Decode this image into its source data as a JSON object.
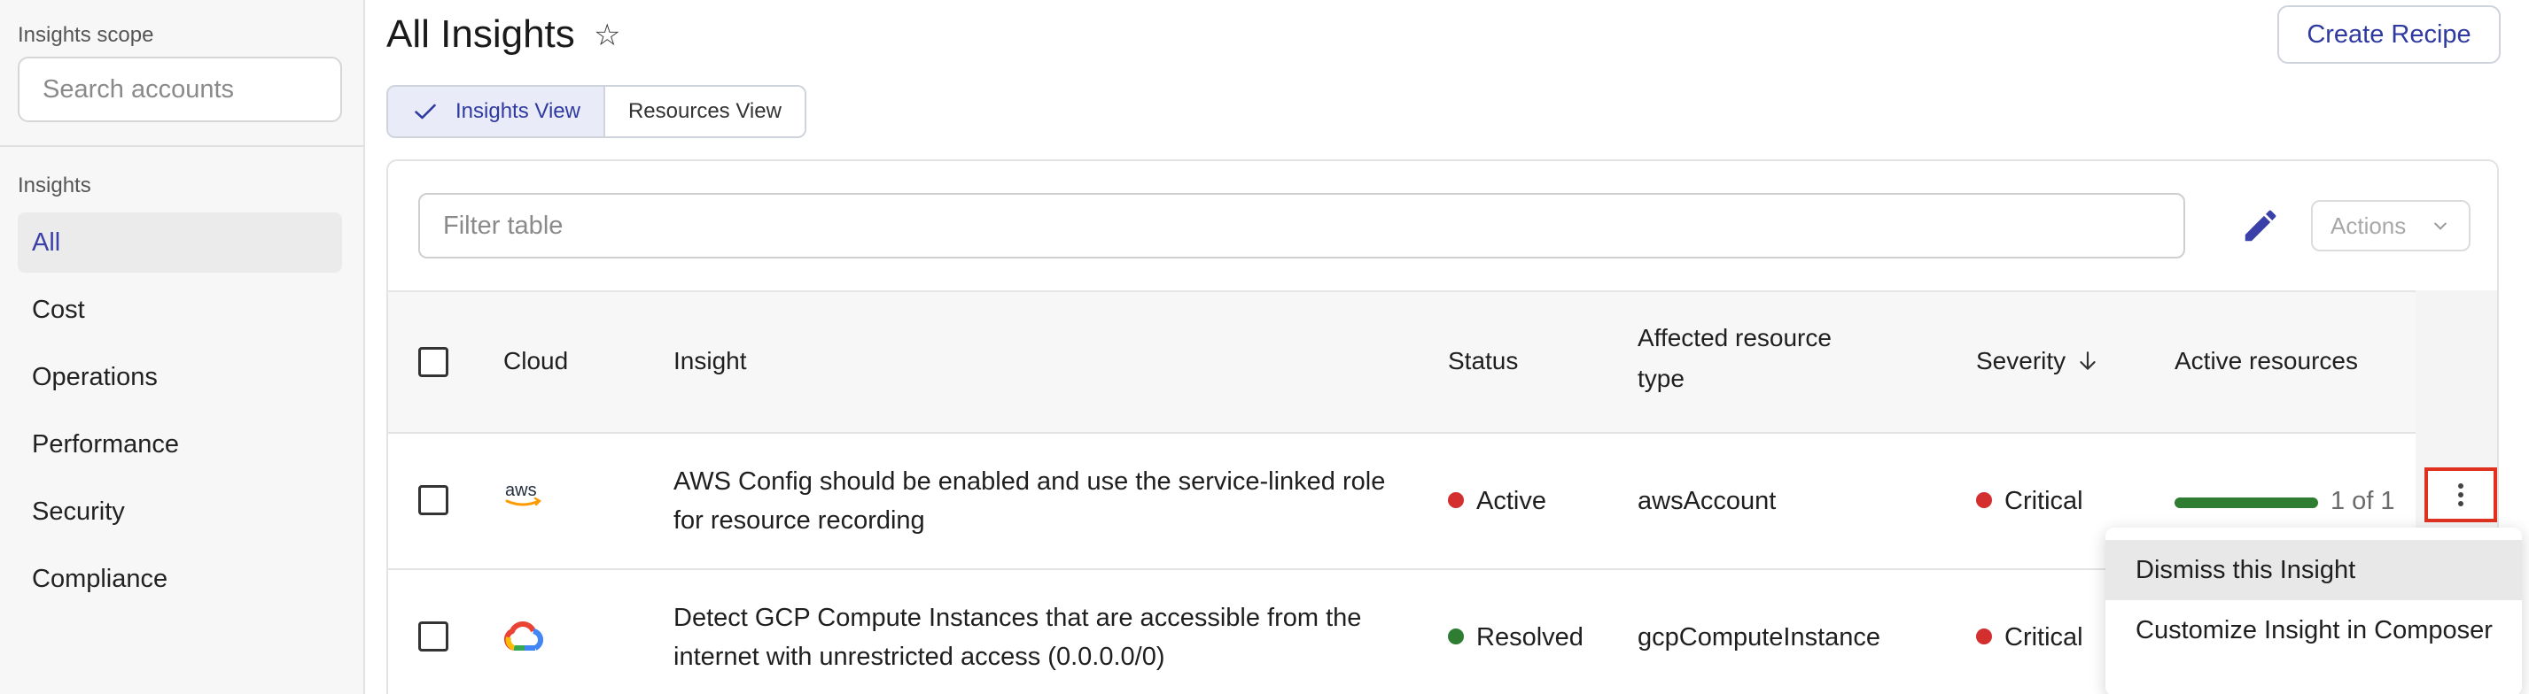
{
  "sidebar": {
    "scope_label": "Insights scope",
    "search_placeholder": "Search accounts",
    "insights_label": "Insights",
    "items": [
      {
        "label": "All",
        "active": true
      },
      {
        "label": "Cost"
      },
      {
        "label": "Operations"
      },
      {
        "label": "Performance"
      },
      {
        "label": "Security"
      },
      {
        "label": "Compliance"
      }
    ]
  },
  "header": {
    "title": "All Insights",
    "create_button": "Create Recipe"
  },
  "view_toggle": {
    "insights_view": "Insights View",
    "resources_view": "Resources View"
  },
  "toolbar": {
    "filter_placeholder": "Filter table",
    "actions_label": "Actions"
  },
  "table": {
    "columns": {
      "cloud": "Cloud",
      "insight": "Insight",
      "status": "Status",
      "affected_line1": "Affected resource",
      "affected_line2": "type",
      "severity": "Severity",
      "active_resources": "Active resources"
    },
    "rows": [
      {
        "cloud": "aws",
        "insight_line1": "AWS Config should be enabled and use the service-linked role",
        "insight_line2": "for resource recording",
        "status": "Active",
        "status_color": "#d32f2f",
        "resource_type": "awsAccount",
        "severity": "Critical",
        "severity_color": "#d32f2f",
        "active_resources": "1 of 1",
        "active_fraction": 1.0
      },
      {
        "cloud": "gcp",
        "insight_line1": "Detect GCP Compute Instances that are accessible from the",
        "insight_line2": "internet with unrestricted access (0.0.0.0/0)",
        "status": "Resolved",
        "status_color": "#2e7d32",
        "resource_type": "gcpComputeInstance",
        "severity": "Critical",
        "severity_color": "#d32f2f"
      }
    ]
  },
  "context_menu": {
    "items": [
      "Dismiss this Insight",
      "Customize Insight in Composer"
    ]
  },
  "colors": {
    "accent": "#2f3aa0",
    "highlight_border": "#e0311f"
  }
}
